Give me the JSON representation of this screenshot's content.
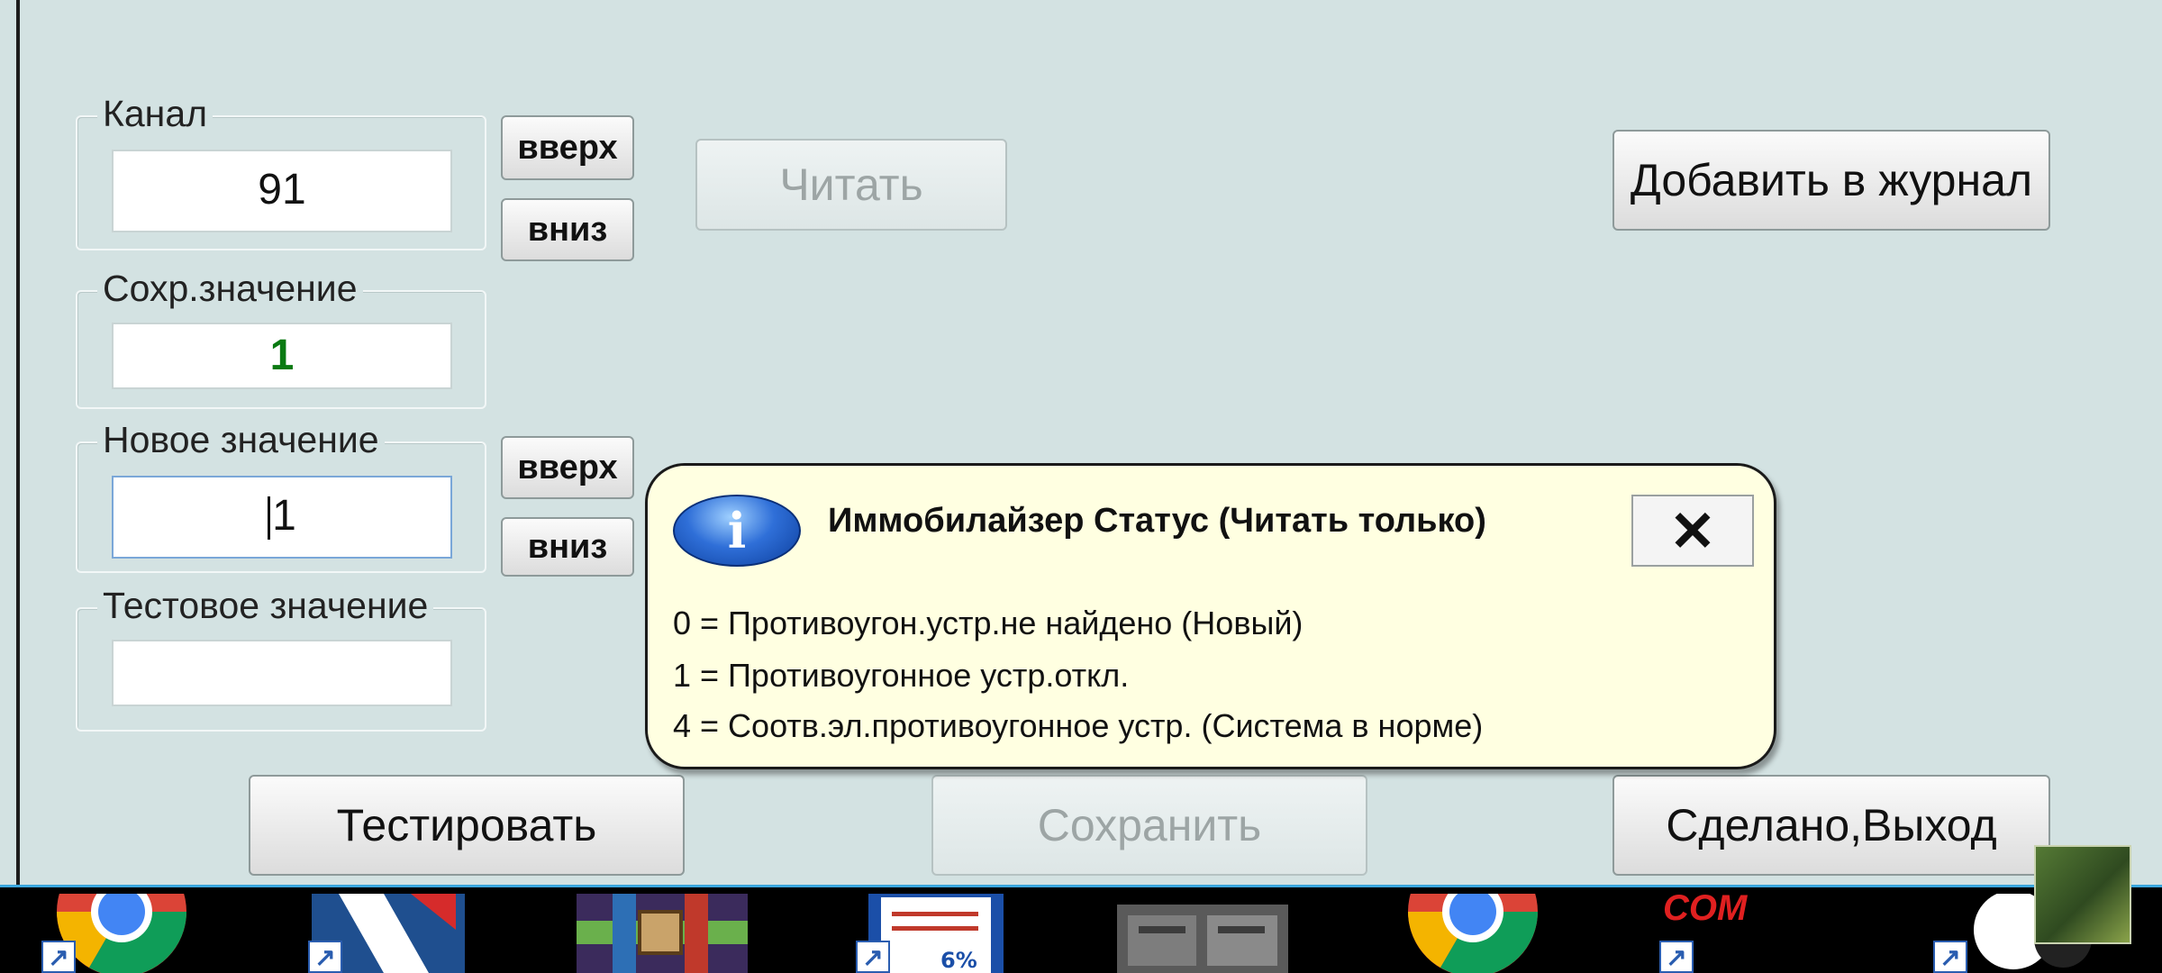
{
  "channel": {
    "label": "Канал",
    "value": "91",
    "up_label": "вверх",
    "down_label": "вниз"
  },
  "saved_value": {
    "label": "Сохр.значение",
    "value": "1"
  },
  "new_value": {
    "label": "Новое значение",
    "value": "1",
    "up_label": "вверх",
    "down_label": "вниз"
  },
  "test_value": {
    "label": "Тестовое значение",
    "value": ""
  },
  "buttons": {
    "read": "Читать",
    "add_to_log": "Добавить в журнал",
    "test": "Тестировать",
    "save": "Сохранить",
    "done_exit": "Сделано,Выход"
  },
  "tooltip": {
    "icon": "info-icon",
    "title": "Иммобилайзер Статус  (Читать только)",
    "close_label": "✕",
    "lines": [
      "0 = Противоугон.устр.не найдено (Новый)",
      "1 = Противоугонное устр.откл.",
      "4 = Соотв.эл.противоугонное устр. (Система в норме)"
    ]
  },
  "taskbar": {
    "items": [
      "chrome-icon",
      "app-icon",
      "archive-icon",
      "document-icon",
      "image-icon",
      "chrome-icon",
      "com-icon",
      "app-icon"
    ],
    "com_text": "COM"
  },
  "colors": {
    "window_bg": "#d3e2e2",
    "tooltip_bg": "#ffffe1",
    "saved_value_text": "#0a7a12",
    "taskbar_accent": "#3aa6de"
  }
}
